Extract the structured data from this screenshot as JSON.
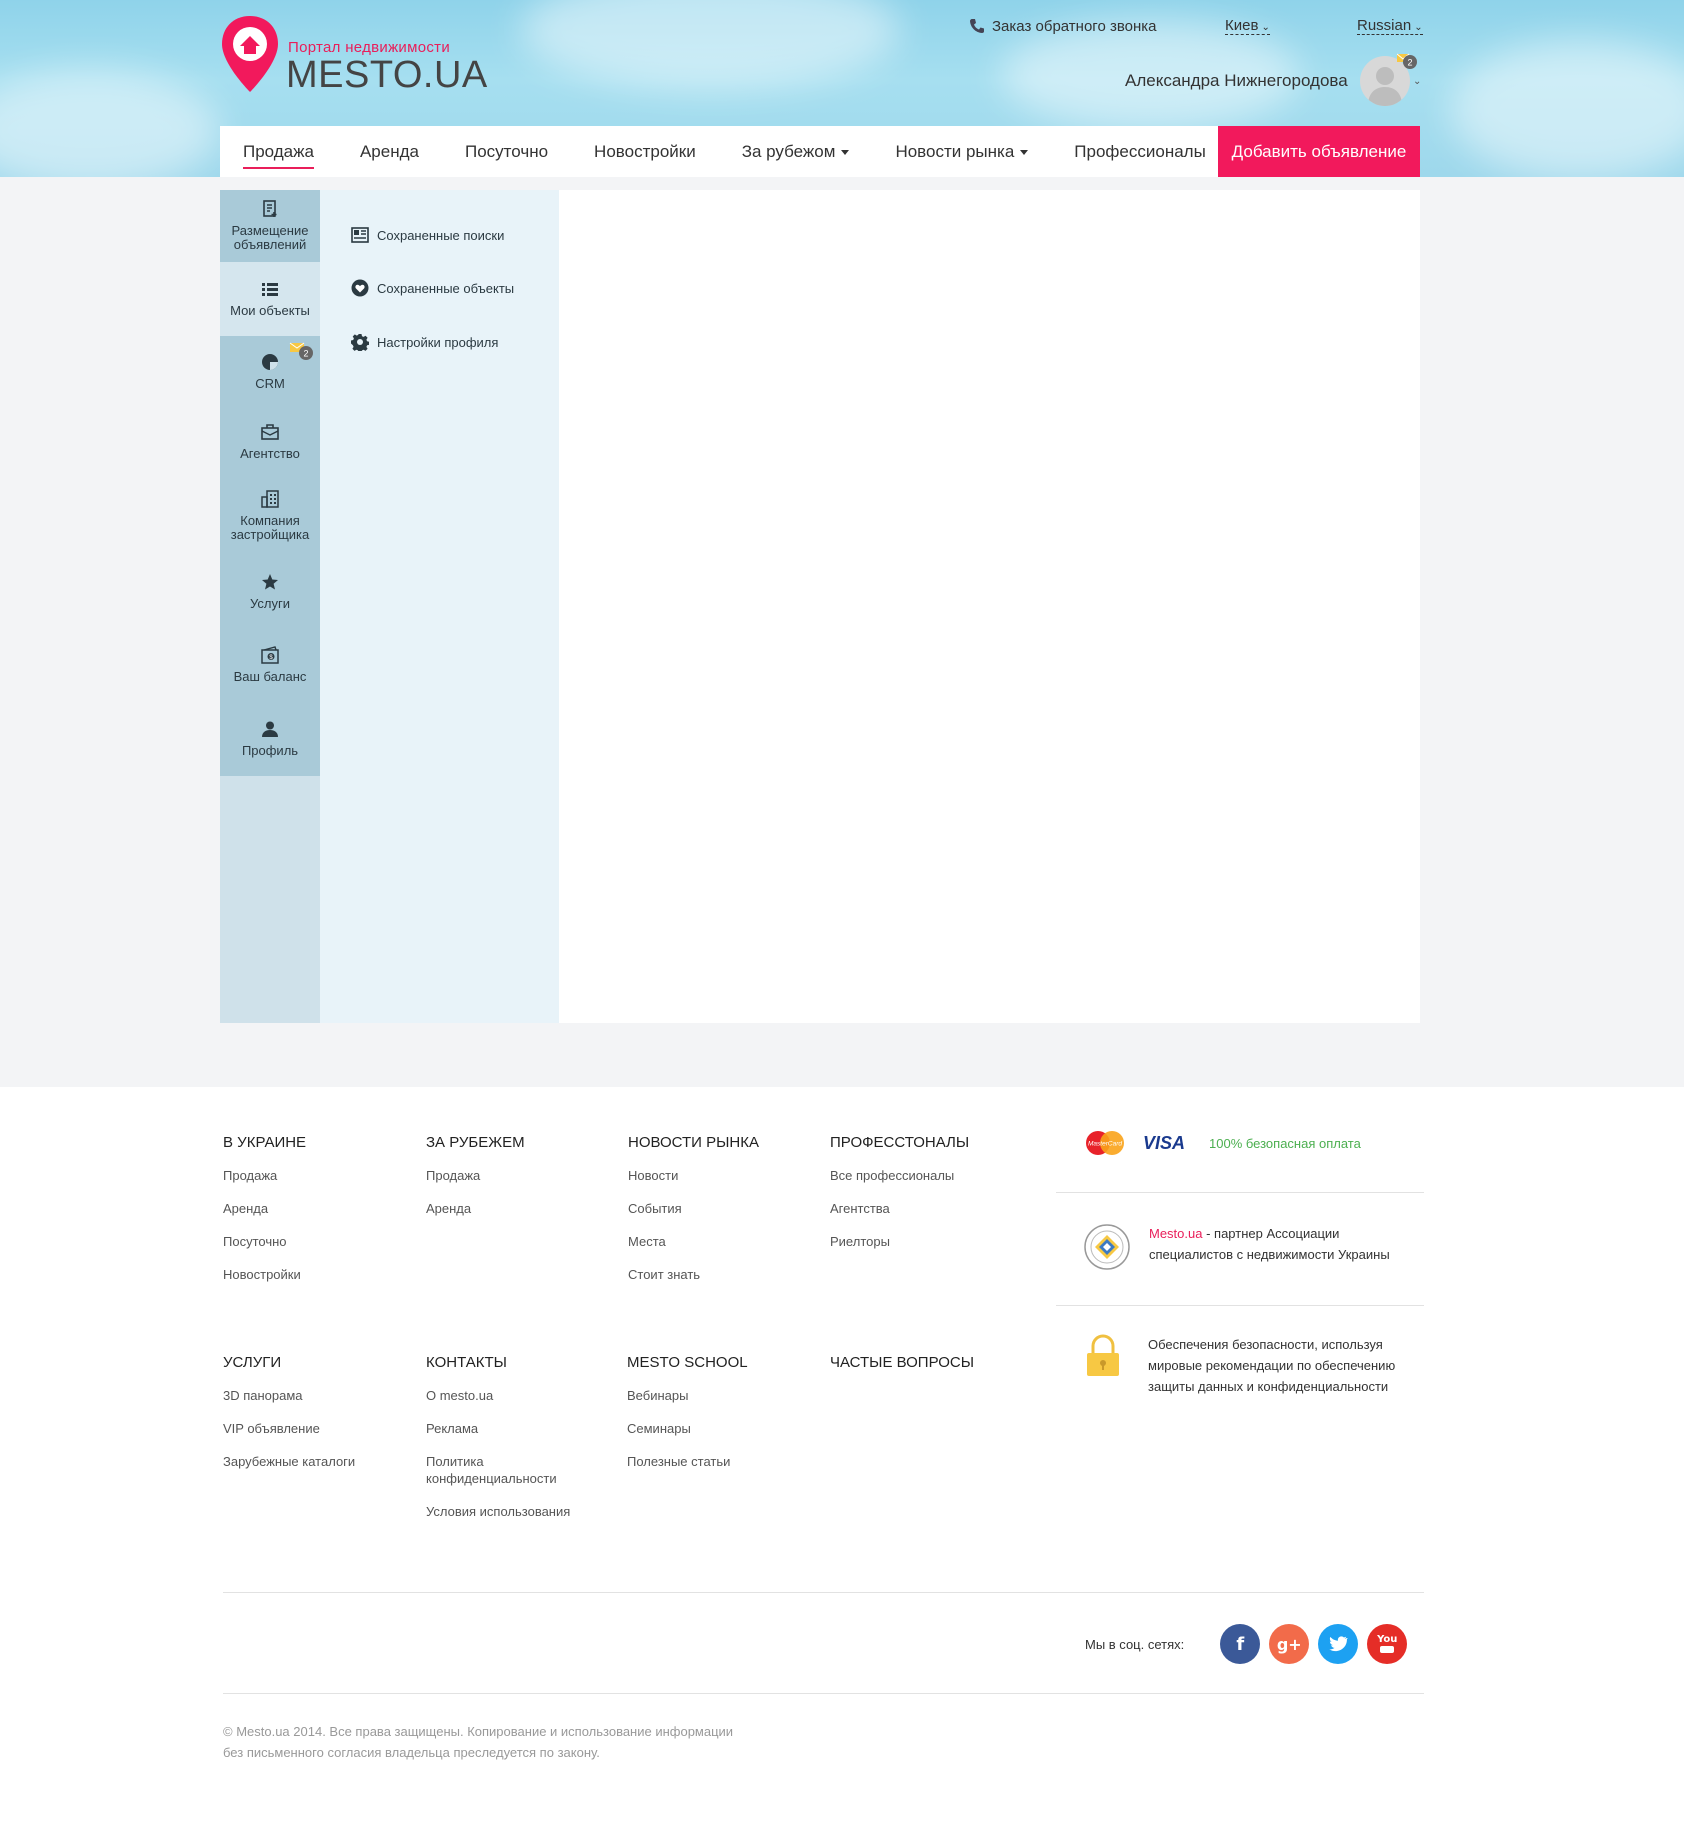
{
  "header": {
    "logo_subtitle": "Портал недвижимости",
    "logo_title": "MESTO.UA",
    "callback_label": "Заказ обратного звонка",
    "city": "Киев",
    "language": "Russian",
    "username": "Александра Нижнегородова",
    "notifications_count": "2"
  },
  "nav": {
    "items": [
      {
        "label": "Продажа"
      },
      {
        "label": "Аренда"
      },
      {
        "label": "Посуточно"
      },
      {
        "label": "Новостройки"
      },
      {
        "label": "За рубежом"
      },
      {
        "label": "Новости рынка"
      },
      {
        "label": "Профессионалы"
      }
    ],
    "add_button": "Добавить объявление"
  },
  "sidebar": {
    "items": [
      {
        "label": "Размещение объявлений",
        "icon": "add-listing-icon"
      },
      {
        "label": "Мои объекты",
        "icon": "list-icon"
      },
      {
        "label": "CRM",
        "icon": "crm-icon",
        "badge": "2"
      },
      {
        "label": "Агентство",
        "icon": "briefcase-icon"
      },
      {
        "label": "Компания застройщика",
        "icon": "building-icon"
      },
      {
        "label": "Услуги",
        "icon": "star-icon"
      },
      {
        "label": "Ваш баланс",
        "icon": "wallet-icon"
      },
      {
        "label": "Профиль",
        "icon": "user-icon"
      }
    ]
  },
  "submenu": {
    "items": [
      {
        "label": "Сохраненные поиски",
        "icon": "saved-search-icon"
      },
      {
        "label": "Сохраненные объекты",
        "icon": "heart-icon"
      },
      {
        "label": "Настройки профиля",
        "icon": "gear-icon"
      }
    ]
  },
  "footer": {
    "columns": [
      {
        "title": "В УКРАИНЕ",
        "links": [
          "Продажа",
          "Аренда",
          "Посуточно",
          "Новостройки"
        ]
      },
      {
        "title": "ЗА РУБЕЖЕМ",
        "links": [
          "Продажа",
          "Аренда"
        ]
      },
      {
        "title": "НОВОСТИ РЫНКА",
        "links": [
          "Новости",
          "События",
          "Места",
          "Стоит знать"
        ]
      },
      {
        "title": "ПРОФЕССТОНАЛЫ",
        "links": [
          "Все профессионалы",
          "Агентства",
          "Риелторы"
        ]
      },
      {
        "title": "УСЛУГИ",
        "links": [
          "3D панорама",
          "VIP объявление",
          "Зарубежные каталоги"
        ]
      },
      {
        "title": "КОНТАКТЫ",
        "links": [
          "О mesto.ua",
          "Реклама",
          "Политика конфиденциальности",
          "Условия использования"
        ]
      },
      {
        "title": "MESTO SCHOOL",
        "links": [
          "Вебинары",
          "Семинары",
          "Полезные статьи"
        ]
      },
      {
        "title": "ЧАСТЫЕ ВОПРОСЫ",
        "links": []
      }
    ],
    "payment_text": "100% безопасная оплата",
    "visa": "VISA",
    "mastercard": "MasterCard",
    "partner_brand": "Mesto.ua",
    "partner_text": " - партнер Ассоциации специалистов  с недвижимости Украины",
    "secure_text": "Обеспечения безопасности, используя мировые рекомендации по обеспечению защиты данных и конфиденциальности",
    "social_label": "Мы в соц. сетях:",
    "social": [
      {
        "name": "facebook",
        "glyph": "f",
        "color": "#3b5998"
      },
      {
        "name": "google-plus",
        "glyph": "g+",
        "color": "#f26b4a"
      },
      {
        "name": "twitter",
        "glyph": "t",
        "color": "#1da1f2"
      },
      {
        "name": "youtube",
        "glyph": "You",
        "color": "#e52d27"
      }
    ],
    "copyright_line1": "© Mesto.ua 2014. Все права защищены. Копирование и использование информации",
    "copyright_line2": "без письменного согласия владельца преследуется по закону."
  },
  "colors": {
    "accent": "#f2195c",
    "sidebar": "#a9cad8",
    "submenu_bg": "#e8f3f9"
  }
}
